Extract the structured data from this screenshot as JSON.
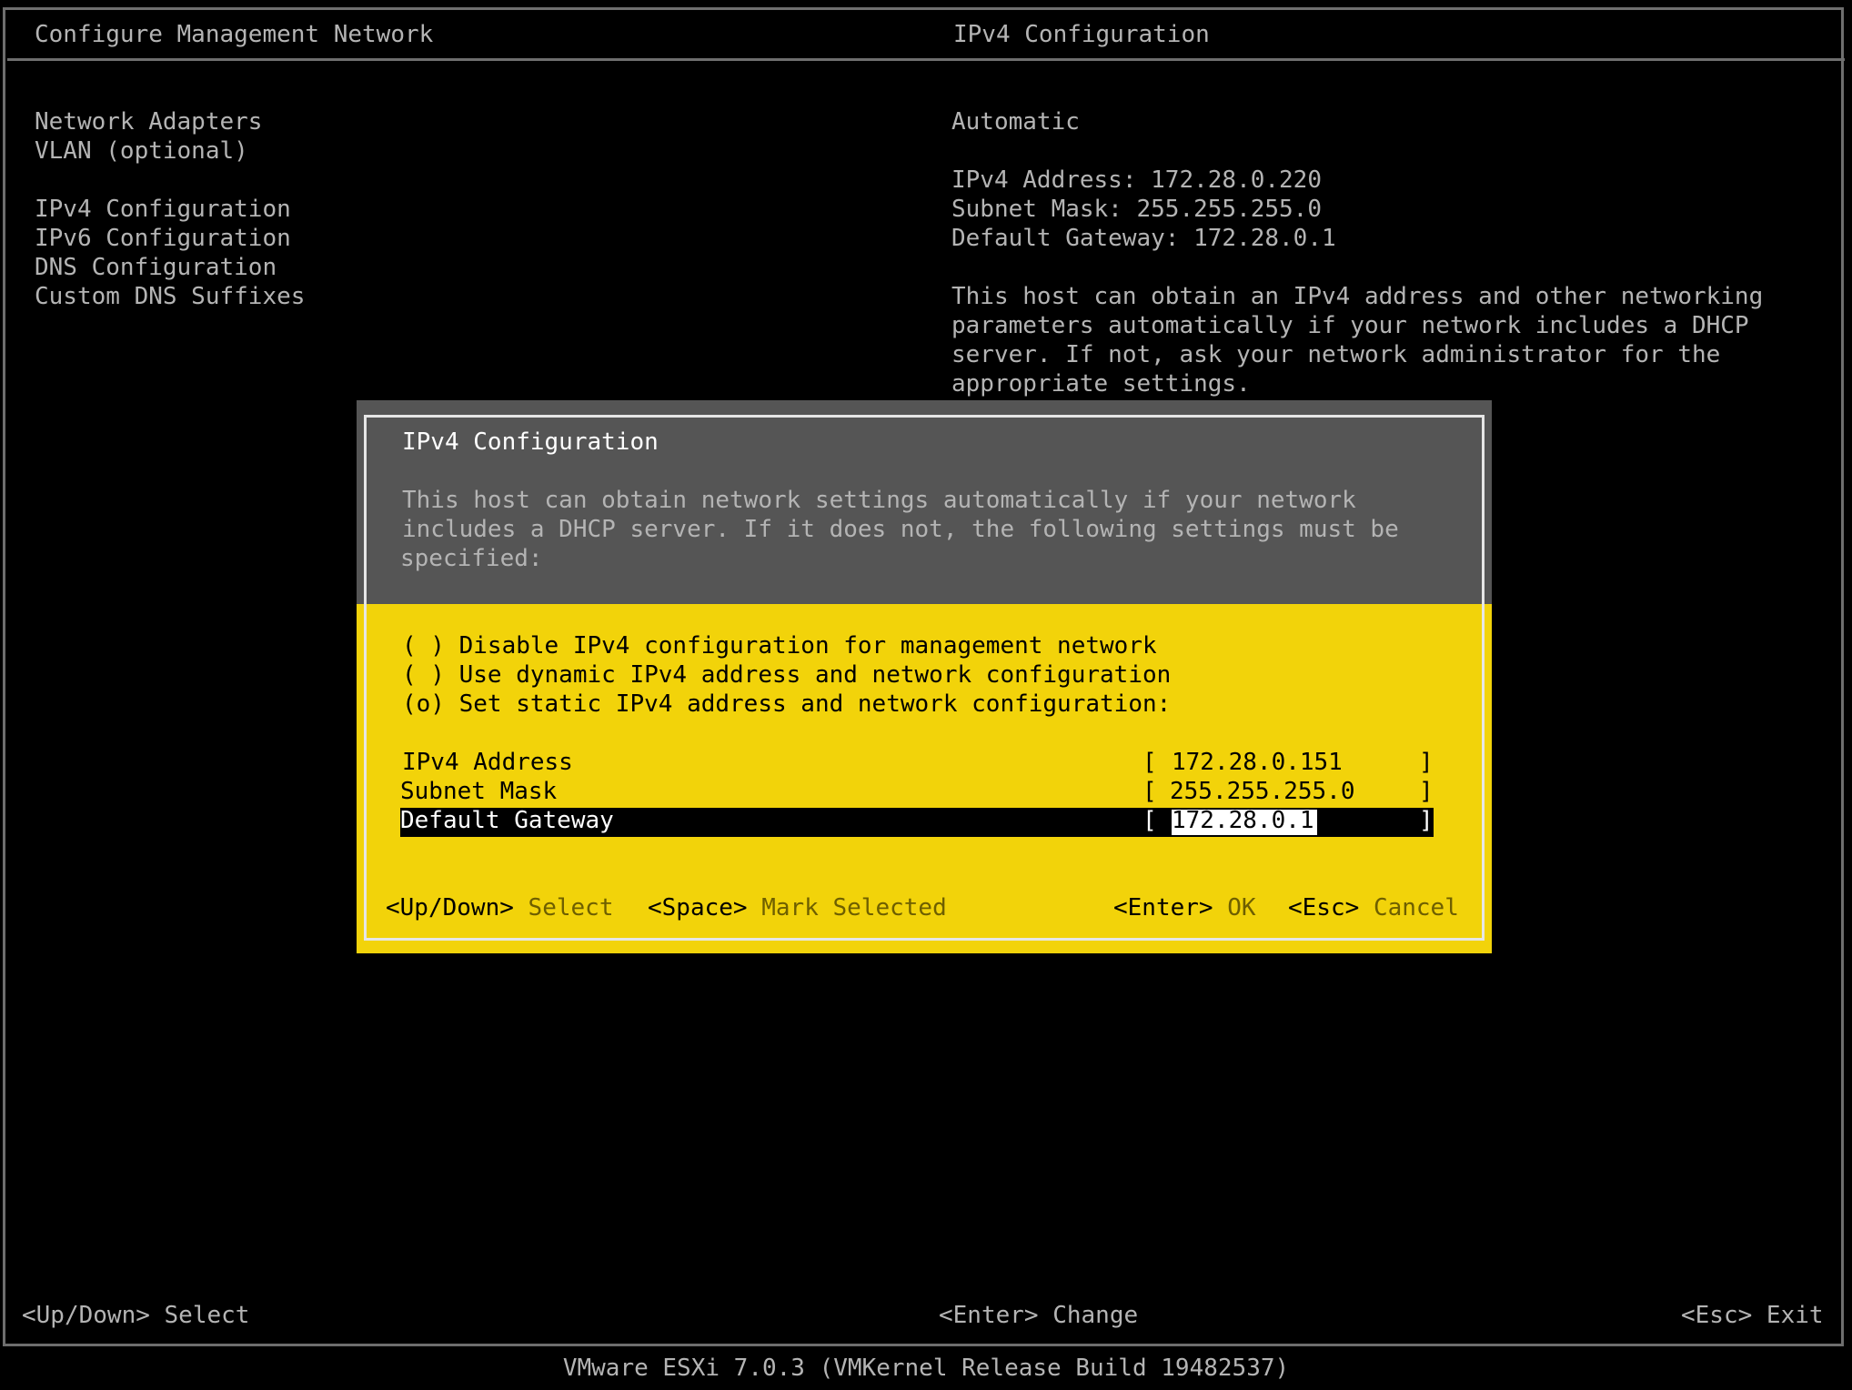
{
  "header": {
    "left_title": "Configure Management Network",
    "right_title": "IPv4 Configuration"
  },
  "menu": {
    "items": [
      "Network Adapters",
      "VLAN (optional)",
      "IPv4 Configuration",
      "IPv6 Configuration",
      "DNS Configuration",
      "Custom DNS Suffixes"
    ]
  },
  "info": {
    "mode": "Automatic",
    "ipv4_address_line": "IPv4 Address: 172.28.0.220",
    "subnet_mask_line": "Subnet Mask: 255.255.255.0",
    "gateway_line": "Default Gateway: 172.28.0.1",
    "description": [
      "This host can obtain an IPv4 address and other networking",
      "parameters automatically if your network includes a DHCP",
      "server. If not, ask your network administrator for the",
      "appropriate settings."
    ]
  },
  "dialog": {
    "title": "IPv4 Configuration",
    "description": [
      "This host can obtain network settings automatically if your network",
      "includes a DHCP server. If it does not, the following settings must be",
      "specified:"
    ],
    "options": [
      "( ) Disable IPv4 configuration for management network",
      "( ) Use dynamic IPv4 address and network configuration",
      "(o) Set static IPv4 address and network configuration:"
    ],
    "fields": [
      {
        "label": "IPv4 Address",
        "value": "172.28.0.151"
      },
      {
        "label": "Subnet Mask",
        "value": "255.255.255.0"
      },
      {
        "label": "Default Gateway",
        "value": "172.28.0.1"
      }
    ],
    "bracket_open": "[",
    "bracket_close": "]",
    "footer": {
      "updown_key": "<Up/Down>",
      "updown_action": "Select",
      "space_key": "<Space>",
      "space_action": "Mark Selected",
      "enter_key": "<Enter>",
      "enter_action": "OK",
      "esc_key": "<Esc>",
      "esc_action": "Cancel"
    }
  },
  "footer": {
    "left": "<Up/Down> Select",
    "center": "<Enter> Change",
    "right": "<Esc> Exit"
  },
  "status_bar": "VMware ESXi 7.0.3 (VMKernel Release Build 19482537)",
  "colors": {
    "dialog_bg": "#f2d30a",
    "dialog_header_bg": "#555555",
    "background": "#000000",
    "text": "#b4b4b4"
  }
}
